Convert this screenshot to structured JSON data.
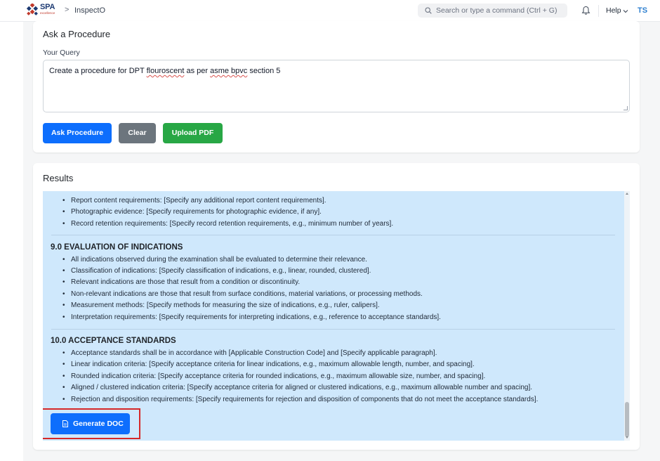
{
  "navbar": {
    "logo_text": "SPA",
    "logo_subtext": "excellence",
    "breadcrumb_separator": ">",
    "breadcrumb": "InspectO",
    "search_placeholder": "Search or type a command (Ctrl + G)",
    "help_label": "Help",
    "avatar_initials": "TS"
  },
  "ask": {
    "title": "Ask a Procedure",
    "query_label": "Your Query",
    "query_parts": [
      "Create a procedure for DPT ",
      "flouroscent",
      " as per ",
      "asme bpvc",
      " section 5"
    ],
    "buttons": {
      "ask": "Ask Procedure",
      "clear": "Clear",
      "upload": "Upload PDF"
    }
  },
  "results": {
    "title": "Results",
    "top_bullets": [
      "Report content requirements: [Specify any additional report content requirements].",
      "Photographic evidence: [Specify requirements for photographic evidence, if any].",
      "Record retention requirements: [Specify record retention requirements, e.g., minimum number of years]."
    ],
    "section9": {
      "title": "9.0 EVALUATION OF INDICATIONS",
      "bullets": [
        "All indications observed during the examination shall be evaluated to determine their relevance.",
        "Classification of indications: [Specify classification of indications, e.g., linear, rounded, clustered].",
        "Relevant indications are those that result from a condition or discontinuity.",
        "Non-relevant indications are those that result from surface conditions, material variations, or processing methods.",
        "Measurement methods: [Specify methods for measuring the size of indications, e.g., ruler, calipers].",
        "Interpretation requirements: [Specify requirements for interpreting indications, e.g., reference to acceptance standards]."
      ]
    },
    "section10": {
      "title": "10.0 ACCEPTANCE STANDARDS",
      "bullets": [
        "Acceptance standards shall be in accordance with [Applicable Construction Code] and [Specify applicable paragraph].",
        "Linear indication criteria: [Specify acceptance criteria for linear indications, e.g., maximum allowable length, number, and spacing].",
        "Rounded indication criteria: [Specify acceptance criteria for rounded indications, e.g., maximum allowable size, number, and spacing].",
        "Aligned / clustered indication criteria: [Specify acceptance criteria for aligned or clustered indications, e.g., maximum allowable number and spacing].",
        "Rejection and disposition requirements: [Specify requirements for rejection and disposition of components that do not meet the acceptance standards]."
      ]
    },
    "generate_label": "Generate DOC"
  },
  "icons": {
    "logo": "spa-logo-icon",
    "search": "search-icon",
    "notifications": "bell-icon",
    "help_dropdown": "chevron-down-icon",
    "generate": "document-icon"
  },
  "colors": {
    "primary": "#0d6efd",
    "secondary": "#6c757d",
    "success": "#28a745",
    "results_bg": "#cfe8fc",
    "highlight_outline": "#d62828"
  }
}
